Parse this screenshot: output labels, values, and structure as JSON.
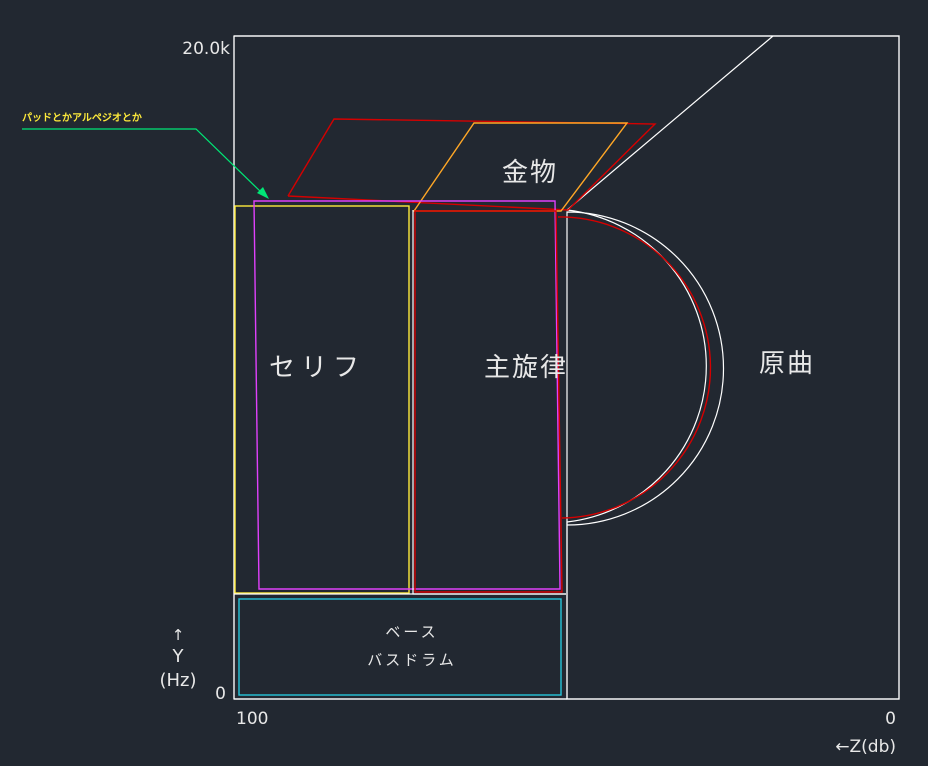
{
  "axes": {
    "y_top": "20.0k",
    "y_bottom": "0",
    "x_left": "100",
    "x_right": "0",
    "y_arrow": "↑",
    "y_title": "Y",
    "y_unit": "(Hz)",
    "x_title": "←Z(db)"
  },
  "regions": {
    "kinzoku": "金物",
    "serifu": "セリフ",
    "shusenritsu": "主旋律",
    "genkyoku": "原曲",
    "base_line1": "ベース",
    "base_line2": "バスドラム"
  },
  "annotation": "パッドとかアルペジオとか",
  "colors": {
    "background": "#222831",
    "outline": "#ffffff",
    "serifu": "#ffeb3b",
    "pad": "#e040fb",
    "metal": "#ffa726",
    "red": "#d50000",
    "bass": "#26c6da",
    "leader": "#00e676"
  }
}
